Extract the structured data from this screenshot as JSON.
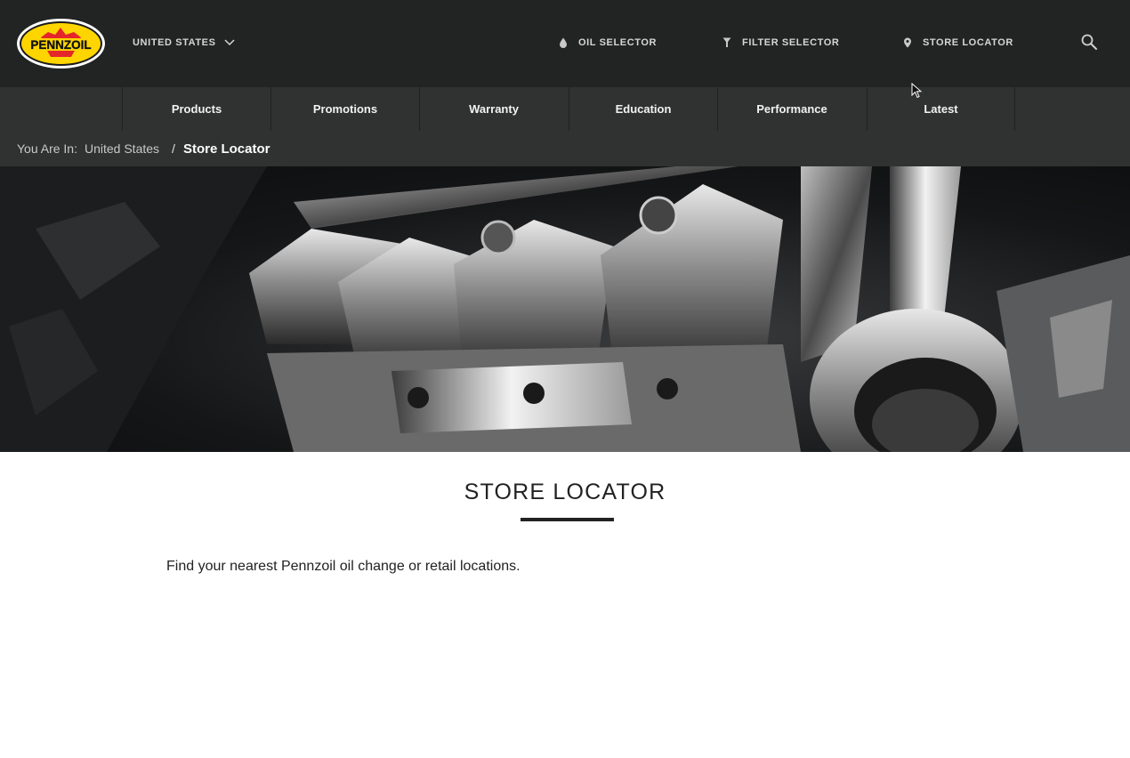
{
  "header": {
    "logo_text": "PENNZOIL",
    "country_selector": {
      "label": "UNITED STATES",
      "icon": "chevron-down-icon"
    },
    "utility_links": [
      {
        "label": "OIL SELECTOR",
        "icon": "oil-drop-icon"
      },
      {
        "label": "FILTER SELECTOR",
        "icon": "filter-funnel-icon"
      },
      {
        "label": "STORE LOCATOR",
        "icon": "map-pin-icon"
      }
    ],
    "search_icon": "search-icon"
  },
  "nav": {
    "items": [
      {
        "label": "Products"
      },
      {
        "label": "Promotions"
      },
      {
        "label": "Warranty"
      },
      {
        "label": "Education"
      },
      {
        "label": "Performance"
      },
      {
        "label": "Latest"
      }
    ]
  },
  "breadcrumb": {
    "prefix": "You Are In:",
    "items": [
      {
        "label": "United States"
      }
    ],
    "separator": "/",
    "current": "Store Locator"
  },
  "main": {
    "title": "STORE LOCATOR",
    "intro": "Find your nearest Pennzoil oil change or retail locations."
  },
  "colors": {
    "header_bg": "#222323",
    "nav_bg": "#303131",
    "logo_yellow": "#ffd500",
    "logo_red": "#e4262b",
    "text_dark": "#222222"
  }
}
